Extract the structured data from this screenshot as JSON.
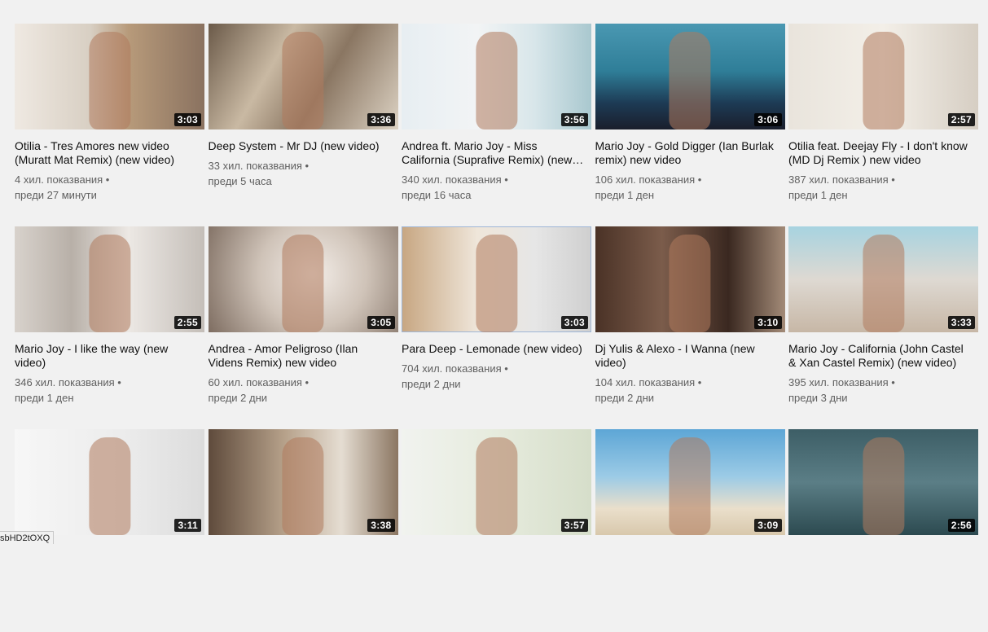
{
  "videos": [
    {
      "title": "Otilia - Tres Amores new video (Muratt Mat Remix) (new video)",
      "views": "4 хил. показвания",
      "age": "преди 27 минути",
      "duration": "3:03"
    },
    {
      "title": "Deep System - Mr DJ (new video)",
      "views": "33 хил. показвания",
      "age": "преди 5 часа",
      "duration": "3:36"
    },
    {
      "title": "Andrea ft. Mario Joy - Miss California (Suprafive Remix) (new video)",
      "views": "340 хил. показвания",
      "age": "преди 16 часа",
      "duration": "3:56"
    },
    {
      "title": "Mario Joy - Gold Digger (Ian Burlak remix) new video",
      "views": "106 хил. показвания",
      "age": "преди 1 ден",
      "duration": "3:06"
    },
    {
      "title": "Otilia feat. Deejay Fly - I don't know (MD Dj Remix ) new video",
      "views": "387 хил. показвания",
      "age": "преди 1 ден",
      "duration": "2:57"
    },
    {
      "title": "Mario Joy - I like the way (new video)",
      "views": "346 хил. показвания",
      "age": "преди 1 ден",
      "duration": "2:55"
    },
    {
      "title": "Andrea - Amor Peligroso (Ilan Videns Remix) new video",
      "views": "60 хил. показвания",
      "age": "преди 2 дни",
      "duration": "3:05"
    },
    {
      "title": "Para Deep - Lemonade (new video)",
      "views": "704 хил. показвания",
      "age": "преди 2 дни",
      "duration": "3:03"
    },
    {
      "title": "Dj Yulis & Alexo - I Wanna (new video)",
      "views": "104 хил. показвания",
      "age": "преди 2 дни",
      "duration": "3:10"
    },
    {
      "title": "Mario Joy - California (John Castel & Xan Castel Remix) (new video)",
      "views": "395 хил. показвания",
      "age": "преди 3 дни",
      "duration": "3:33"
    },
    {
      "duration": "3:11"
    },
    {
      "duration": "3:38"
    },
    {
      "duration": "3:57"
    },
    {
      "duration": "3:09"
    },
    {
      "duration": "2:56"
    }
  ],
  "status_url": "sbHD2tOXQ"
}
